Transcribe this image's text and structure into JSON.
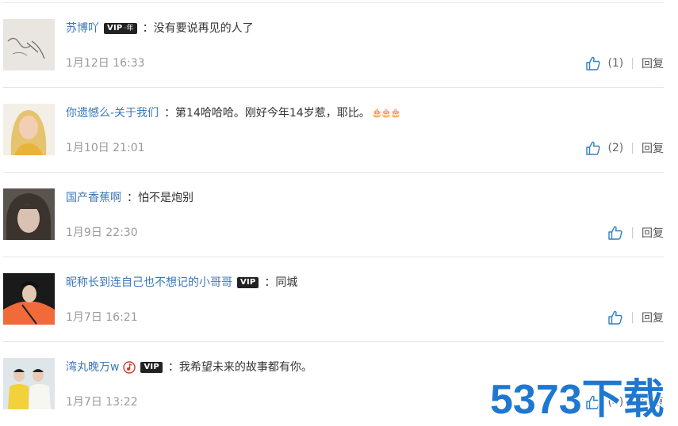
{
  "comments": [
    {
      "username": "苏博吖",
      "vip": true,
      "vip_suffix": "·年",
      "music": false,
      "text": "：没有要说再见的人了",
      "emoji": "",
      "time": "1月12日 16:33",
      "likes": "(1)",
      "reply": "回复"
    },
    {
      "username": "你遗憾么-关于我们",
      "vip": false,
      "vip_suffix": "",
      "music": false,
      "text": "：第14哈哈哈。刚好今年14岁惹，耶比。",
      "emoji": "🎂🎂🎂",
      "time": "1月10日 21:01",
      "likes": "(2)",
      "reply": "回复"
    },
    {
      "username": "国产香蕉啊",
      "vip": false,
      "vip_suffix": "",
      "music": false,
      "text": "：怕不是炮别",
      "emoji": "",
      "time": "1月9日 22:30",
      "likes": "",
      "reply": "回复"
    },
    {
      "username": "昵称长到连自己也不想记的小哥哥",
      "vip": true,
      "vip_suffix": "",
      "music": false,
      "text": "：同城",
      "emoji": "",
      "time": "1月7日 16:21",
      "likes": "",
      "reply": "回复"
    },
    {
      "username": "湾丸晚万w",
      "vip": true,
      "vip_suffix": "",
      "music": true,
      "text": "：我希望未来的故事都有你。",
      "emoji": "",
      "time": "1月7日 13:22",
      "likes": "(4)",
      "reply": "回复"
    }
  ],
  "vip_label": "VIP",
  "watermark": "5373下载",
  "divider": "|",
  "colors": {
    "username": "#3b78b8",
    "like_icon": "#2f7ec7",
    "watermark": "#1e77d0"
  }
}
